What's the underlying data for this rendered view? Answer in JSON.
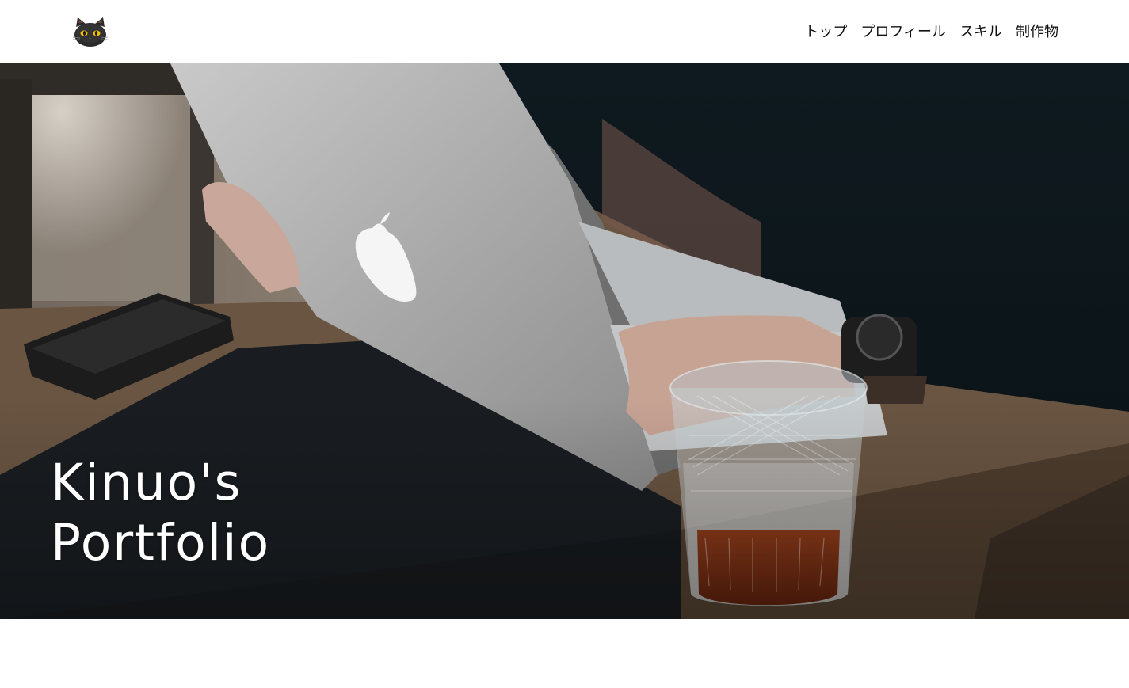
{
  "header": {
    "logo_icon": "black-cat-icon",
    "nav": [
      {
        "label": "トップ"
      },
      {
        "label": "プロフィール"
      },
      {
        "label": "スキル"
      },
      {
        "label": "制作物"
      }
    ]
  },
  "hero": {
    "title_line1": "Kinuo's",
    "title_line2": "Portfolio",
    "image_subject": "laptop-and-glass-on-wooden-table"
  },
  "colors": {
    "header_bg": "#ffffff",
    "nav_text": "#111111",
    "hero_title": "#ffffff"
  }
}
